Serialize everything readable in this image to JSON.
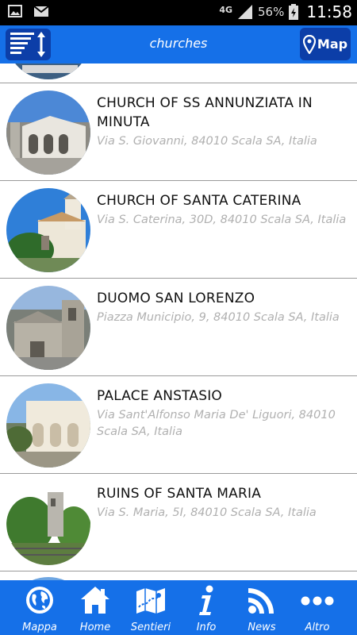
{
  "status_bar": {
    "network": "4G",
    "battery": "56%",
    "time": "11:58"
  },
  "app_bar": {
    "title": "churches",
    "map_label": "Map"
  },
  "items": [
    {
      "name": "CHURCH OF SS ANNUNZIATA IN MINUTA",
      "address": "Via S. Giovanni, 84010 Scala SA, Italia"
    },
    {
      "name": "CHURCH OF SANTA CATERINA",
      "address": "Via S. Caterina, 30D, 84010 Scala SA, Italia"
    },
    {
      "name": "DUOMO SAN LORENZO",
      "address": "Piazza Municipio, 9, 84010 Scala SA, Italia"
    },
    {
      "name": "PALACE ANSTASIO",
      "address": "Via Sant'Alfonso Maria De' Liguori, 84010 Scala SA, Italia"
    },
    {
      "name": "RUINS OF SANTA MARIA",
      "address": "Via S. Maria, 5I, 84010 Scala SA, Italia"
    }
  ],
  "bottom_nav": [
    {
      "label": "Mappa",
      "icon": "globe-icon"
    },
    {
      "label": "Home",
      "icon": "home-icon"
    },
    {
      "label": "Sentieri",
      "icon": "trail-map-icon"
    },
    {
      "label": "Info",
      "icon": "info-icon"
    },
    {
      "label": "News",
      "icon": "rss-icon"
    },
    {
      "label": "Altro",
      "icon": "more-icon"
    }
  ],
  "colors": {
    "primary": "#1570e8",
    "primary_dark": "#0c3ea8",
    "address_text": "#b0b0b0"
  }
}
